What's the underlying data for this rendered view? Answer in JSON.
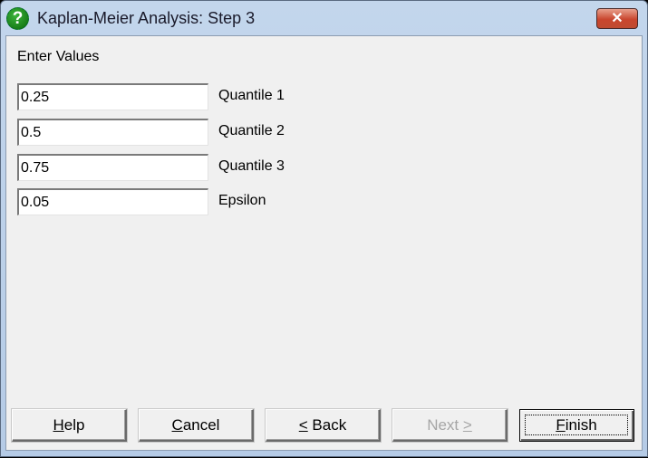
{
  "window": {
    "title": "Kaplan-Meier Analysis: Step 3",
    "icon": "help-question-icon",
    "close_label": "✕"
  },
  "section": {
    "label": "Enter Values"
  },
  "fields": [
    {
      "value": "0.25",
      "label": "Quantile 1"
    },
    {
      "value": "0.5",
      "label": "Quantile 2"
    },
    {
      "value": "0.75",
      "label": "Quantile 3"
    },
    {
      "value": "0.05",
      "label": "Epsilon"
    }
  ],
  "buttons": {
    "help": {
      "mnemonic": "H",
      "rest": "elp",
      "enabled": true
    },
    "cancel": {
      "mnemonic": "C",
      "rest": "ancel",
      "enabled": true
    },
    "back": {
      "mnemonic": "<",
      "rest": " Back",
      "enabled": true
    },
    "next": {
      "prefix": "Next ",
      "mnemonic": ">",
      "enabled": false
    },
    "finish": {
      "mnemonic": "F",
      "rest": "inish",
      "enabled": true,
      "default": true
    }
  }
}
